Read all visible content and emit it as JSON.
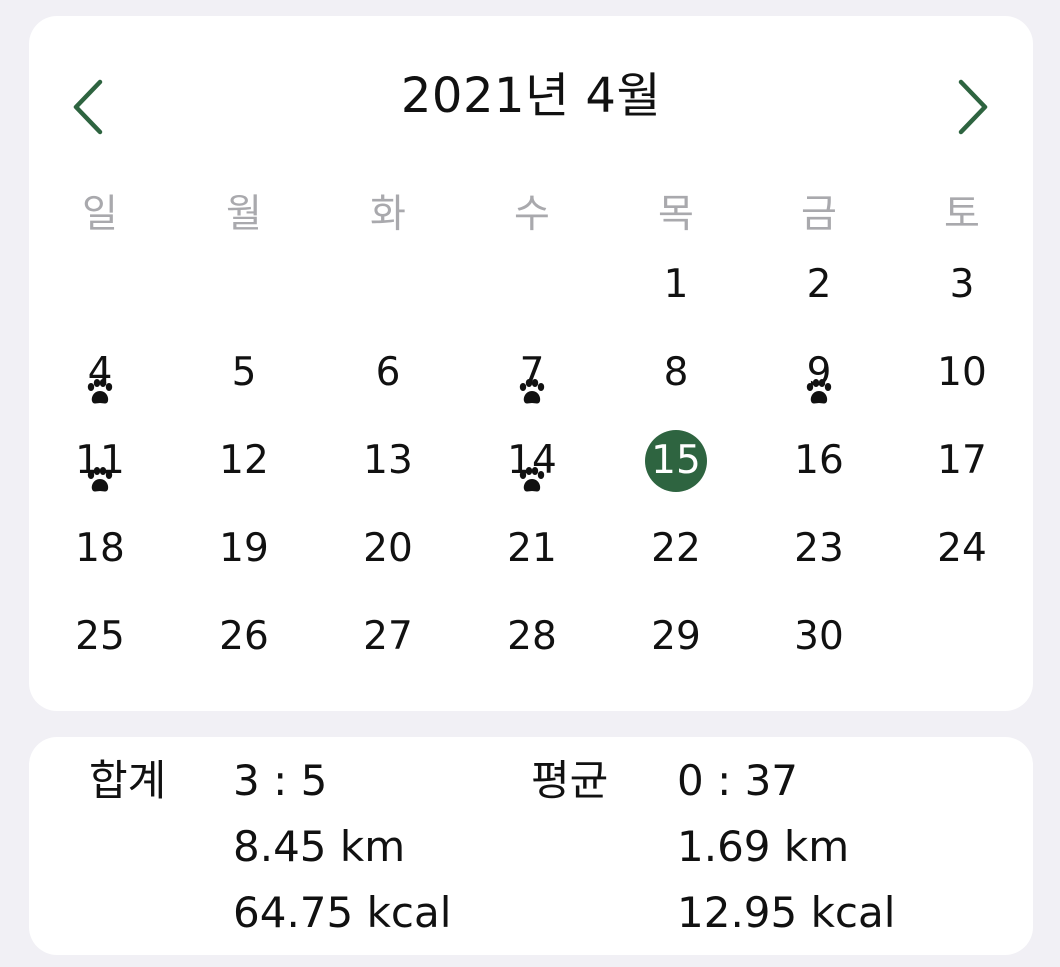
{
  "calendar": {
    "title": "2021년 4월",
    "weekdays": [
      "일",
      "월",
      "화",
      "수",
      "목",
      "금",
      "토"
    ],
    "first_weekday_index": 4,
    "days_in_month": 30,
    "selected_day": 15,
    "paw_days": [
      4,
      7,
      9,
      11,
      14
    ],
    "icons": {
      "prev": "chevron-left-icon",
      "next": "chevron-right-icon",
      "marker": "paw-print-icon"
    }
  },
  "colors": {
    "accent": "#2e6440",
    "text": "#111111",
    "weekday": "#a9a9ad",
    "background": "#f1f0f5",
    "card": "#ffffff"
  },
  "summary": {
    "total": {
      "label": "합계",
      "time": "3 : 5",
      "distance": "8.45 km",
      "calories": "64.75 kcal"
    },
    "average": {
      "label": "평균",
      "time": "0 : 37",
      "distance": "1.69 km",
      "calories": "12.95 kcal"
    }
  }
}
